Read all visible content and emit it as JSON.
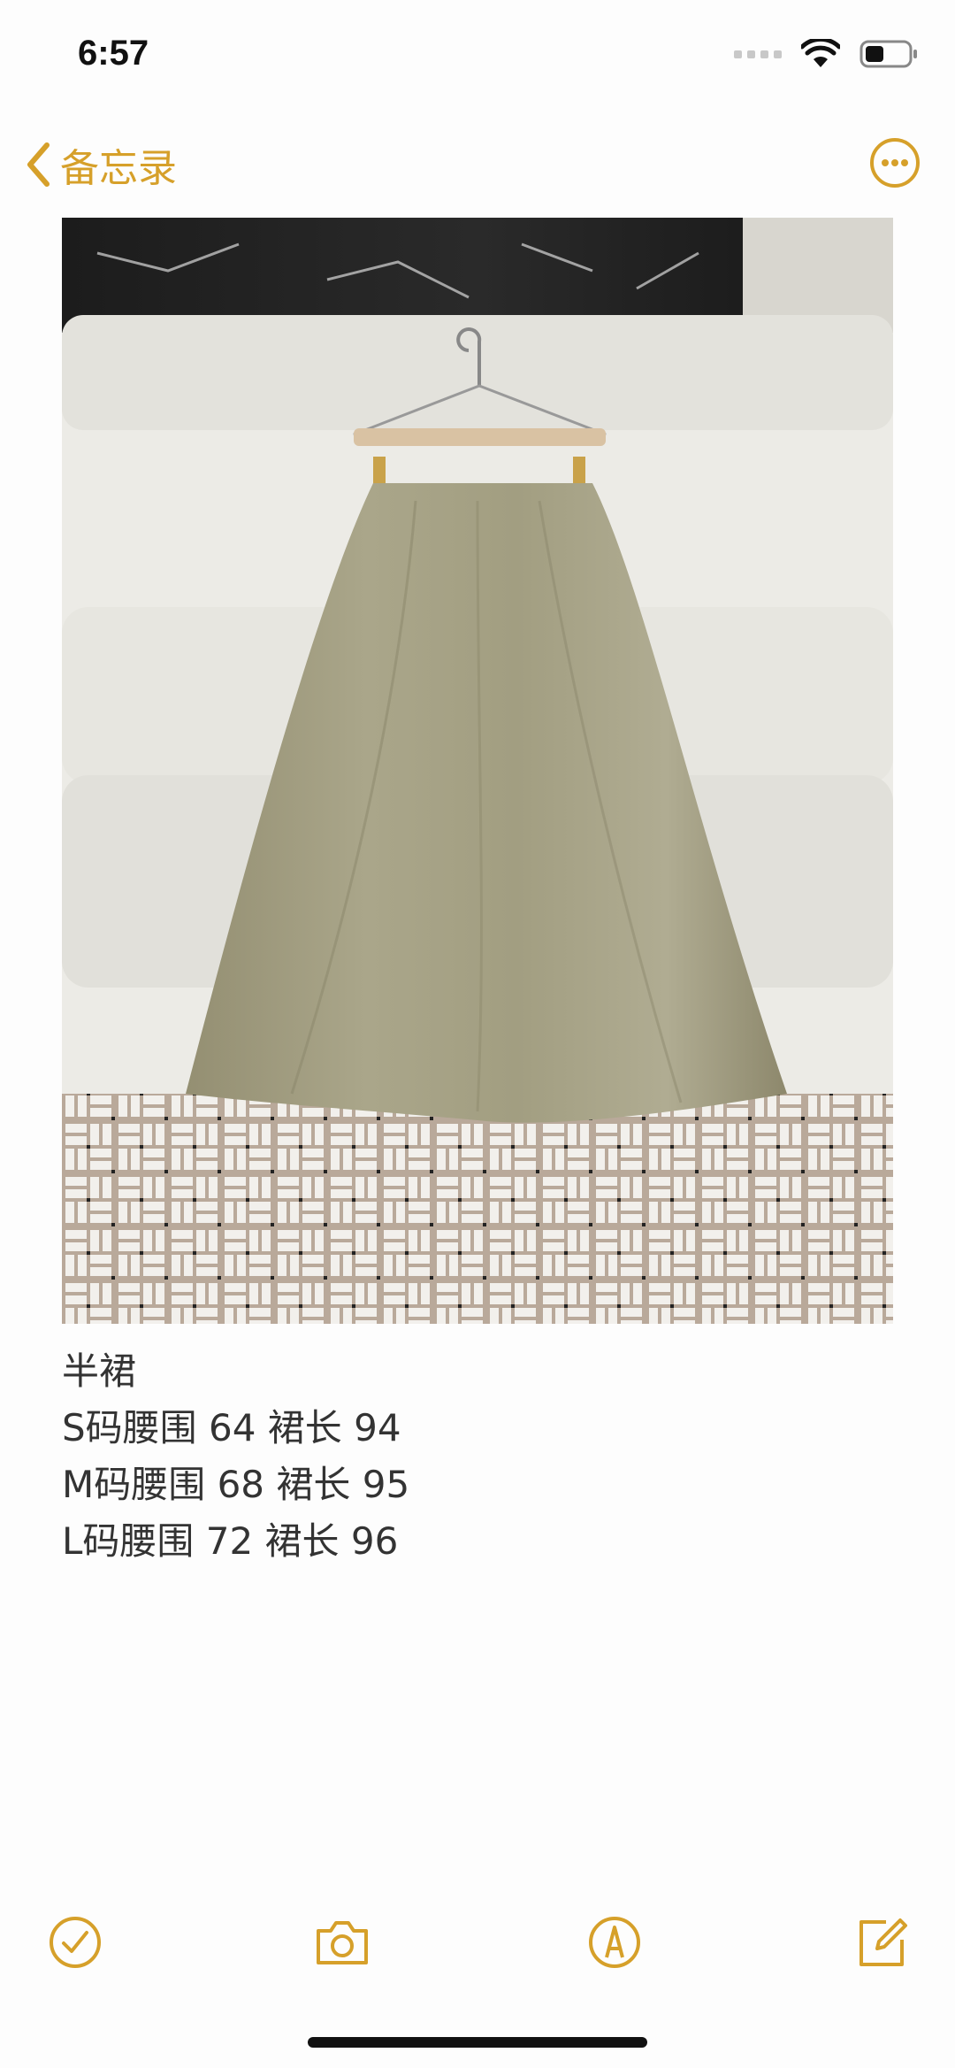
{
  "status": {
    "time": "6:57"
  },
  "nav": {
    "back_label": "备忘录"
  },
  "note": {
    "lines": [
      "半裙",
      "S码腰围 64 裙长 94",
      "M码腰围 68 裙长 95",
      "L码腰围 72 裙长 96"
    ]
  },
  "toolbar": {
    "icons": [
      "checklist-icon",
      "camera-icon",
      "markup-icon",
      "compose-icon"
    ]
  },
  "colors": {
    "accent": "#d6a02a",
    "background": "#fdfdfd"
  }
}
